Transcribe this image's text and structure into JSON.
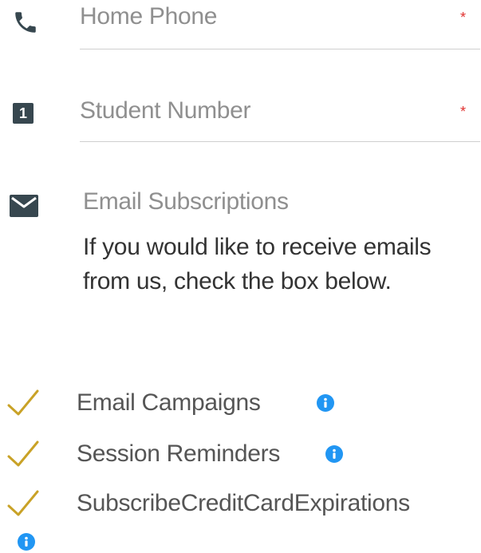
{
  "fields": {
    "home_phone": {
      "placeholder": "Home Phone",
      "required_mark": "*",
      "icon": "phone-icon"
    },
    "student_number": {
      "placeholder": "Student Number",
      "required_mark": "*",
      "icon": "number-one-icon",
      "icon_text": "1"
    }
  },
  "email_subscriptions": {
    "icon": "envelope-icon",
    "title": "Email Subscriptions",
    "description": "If you would like to receive emails from us, check the box below.",
    "options": [
      {
        "label": "Email Campaigns",
        "checked": true,
        "has_info": true
      },
      {
        "label": "Session Reminders",
        "checked": true,
        "has_info": true
      },
      {
        "label": "SubscribeCreditCardExpirations",
        "checked": true,
        "has_info": true
      }
    ]
  },
  "colors": {
    "checkmark": "#c9a227",
    "info": "#2196f3",
    "required": "#e0312f",
    "placeholder": "#8f8f8f",
    "icon_dark": "#37474f"
  }
}
